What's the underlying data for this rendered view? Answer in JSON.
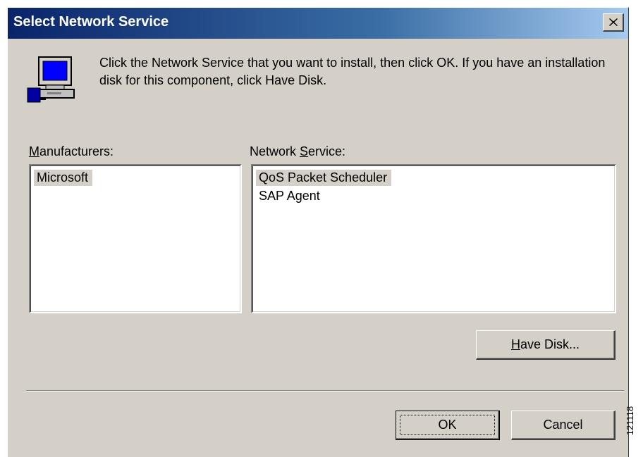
{
  "window": {
    "title": "Select Network Service"
  },
  "message": "Click the Network Service that you want to install, then click OK. If you have an installation disk for this component, click Have Disk.",
  "manufacturers": {
    "label_accel": "M",
    "label_rest": "anufacturers:",
    "items": [
      "Microsoft"
    ],
    "selected_index": 0
  },
  "network_service": {
    "label_prefix": "Network ",
    "label_accel": "S",
    "label_rest": "ervice:",
    "items": [
      "QoS Packet Scheduler",
      "SAP Agent"
    ],
    "selected_index": 0
  },
  "buttons": {
    "have_disk_accel": "H",
    "have_disk_rest": "ave Disk...",
    "ok": "OK",
    "cancel": "Cancel"
  },
  "figure_id": "121118"
}
